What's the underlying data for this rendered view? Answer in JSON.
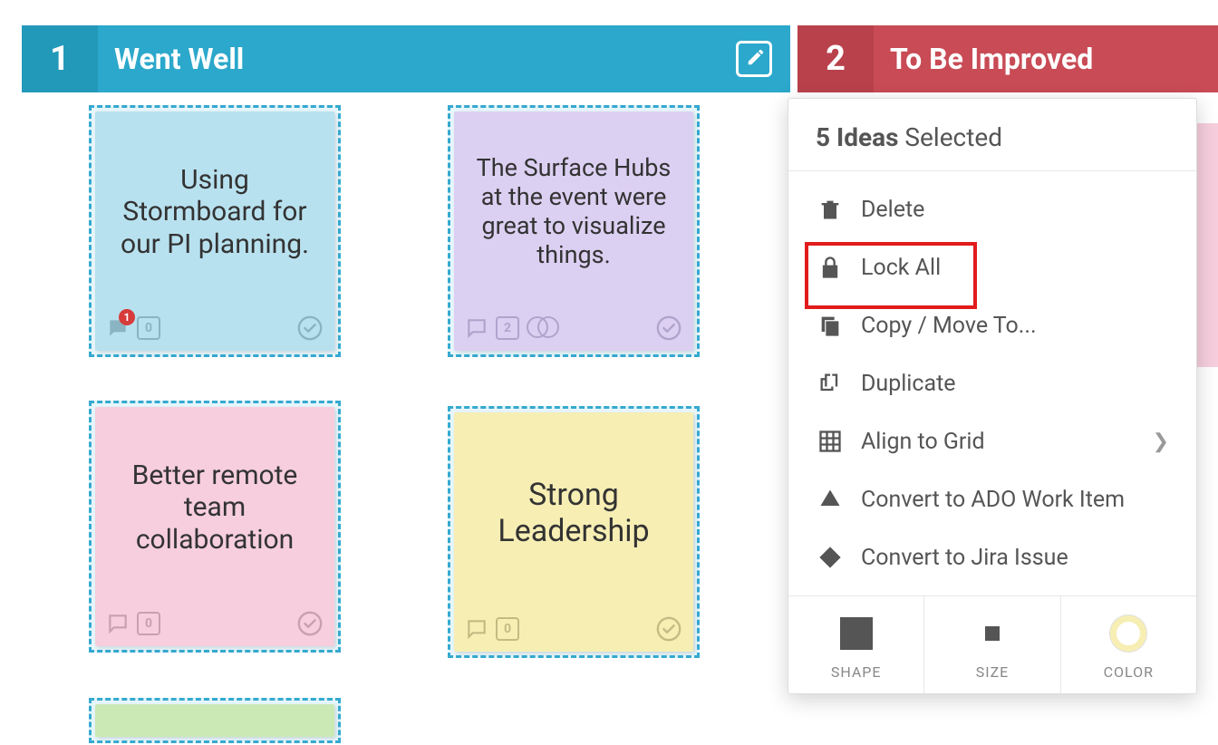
{
  "columns": [
    {
      "num": "1",
      "title": "Went Well"
    },
    {
      "num": "2",
      "title": "To Be Improved"
    }
  ],
  "cards": {
    "c1": {
      "text": "Using Stormboard for our PI planning.",
      "badge": "1",
      "box": "0"
    },
    "c2": {
      "text": "The Surface Hubs at the event were great to visualize things.",
      "box": "2"
    },
    "c3": {
      "text": "Better remote team collaboration",
      "box": "0"
    },
    "c4": {
      "text": "Strong Leadership",
      "box": "0"
    }
  },
  "menu": {
    "count": "5 Ideas",
    "selected_suffix": " Selected",
    "items": {
      "delete": "Delete",
      "lock_all": "Lock All",
      "copy_move": "Copy / Move To...",
      "duplicate": "Duplicate",
      "align_grid": "Align to Grid",
      "convert_ado": "Convert to ADO Work Item",
      "convert_jira": "Convert to Jira Issue"
    },
    "bottom": {
      "shape": "SHAPE",
      "size": "SIZE",
      "color": "COLOR"
    }
  }
}
